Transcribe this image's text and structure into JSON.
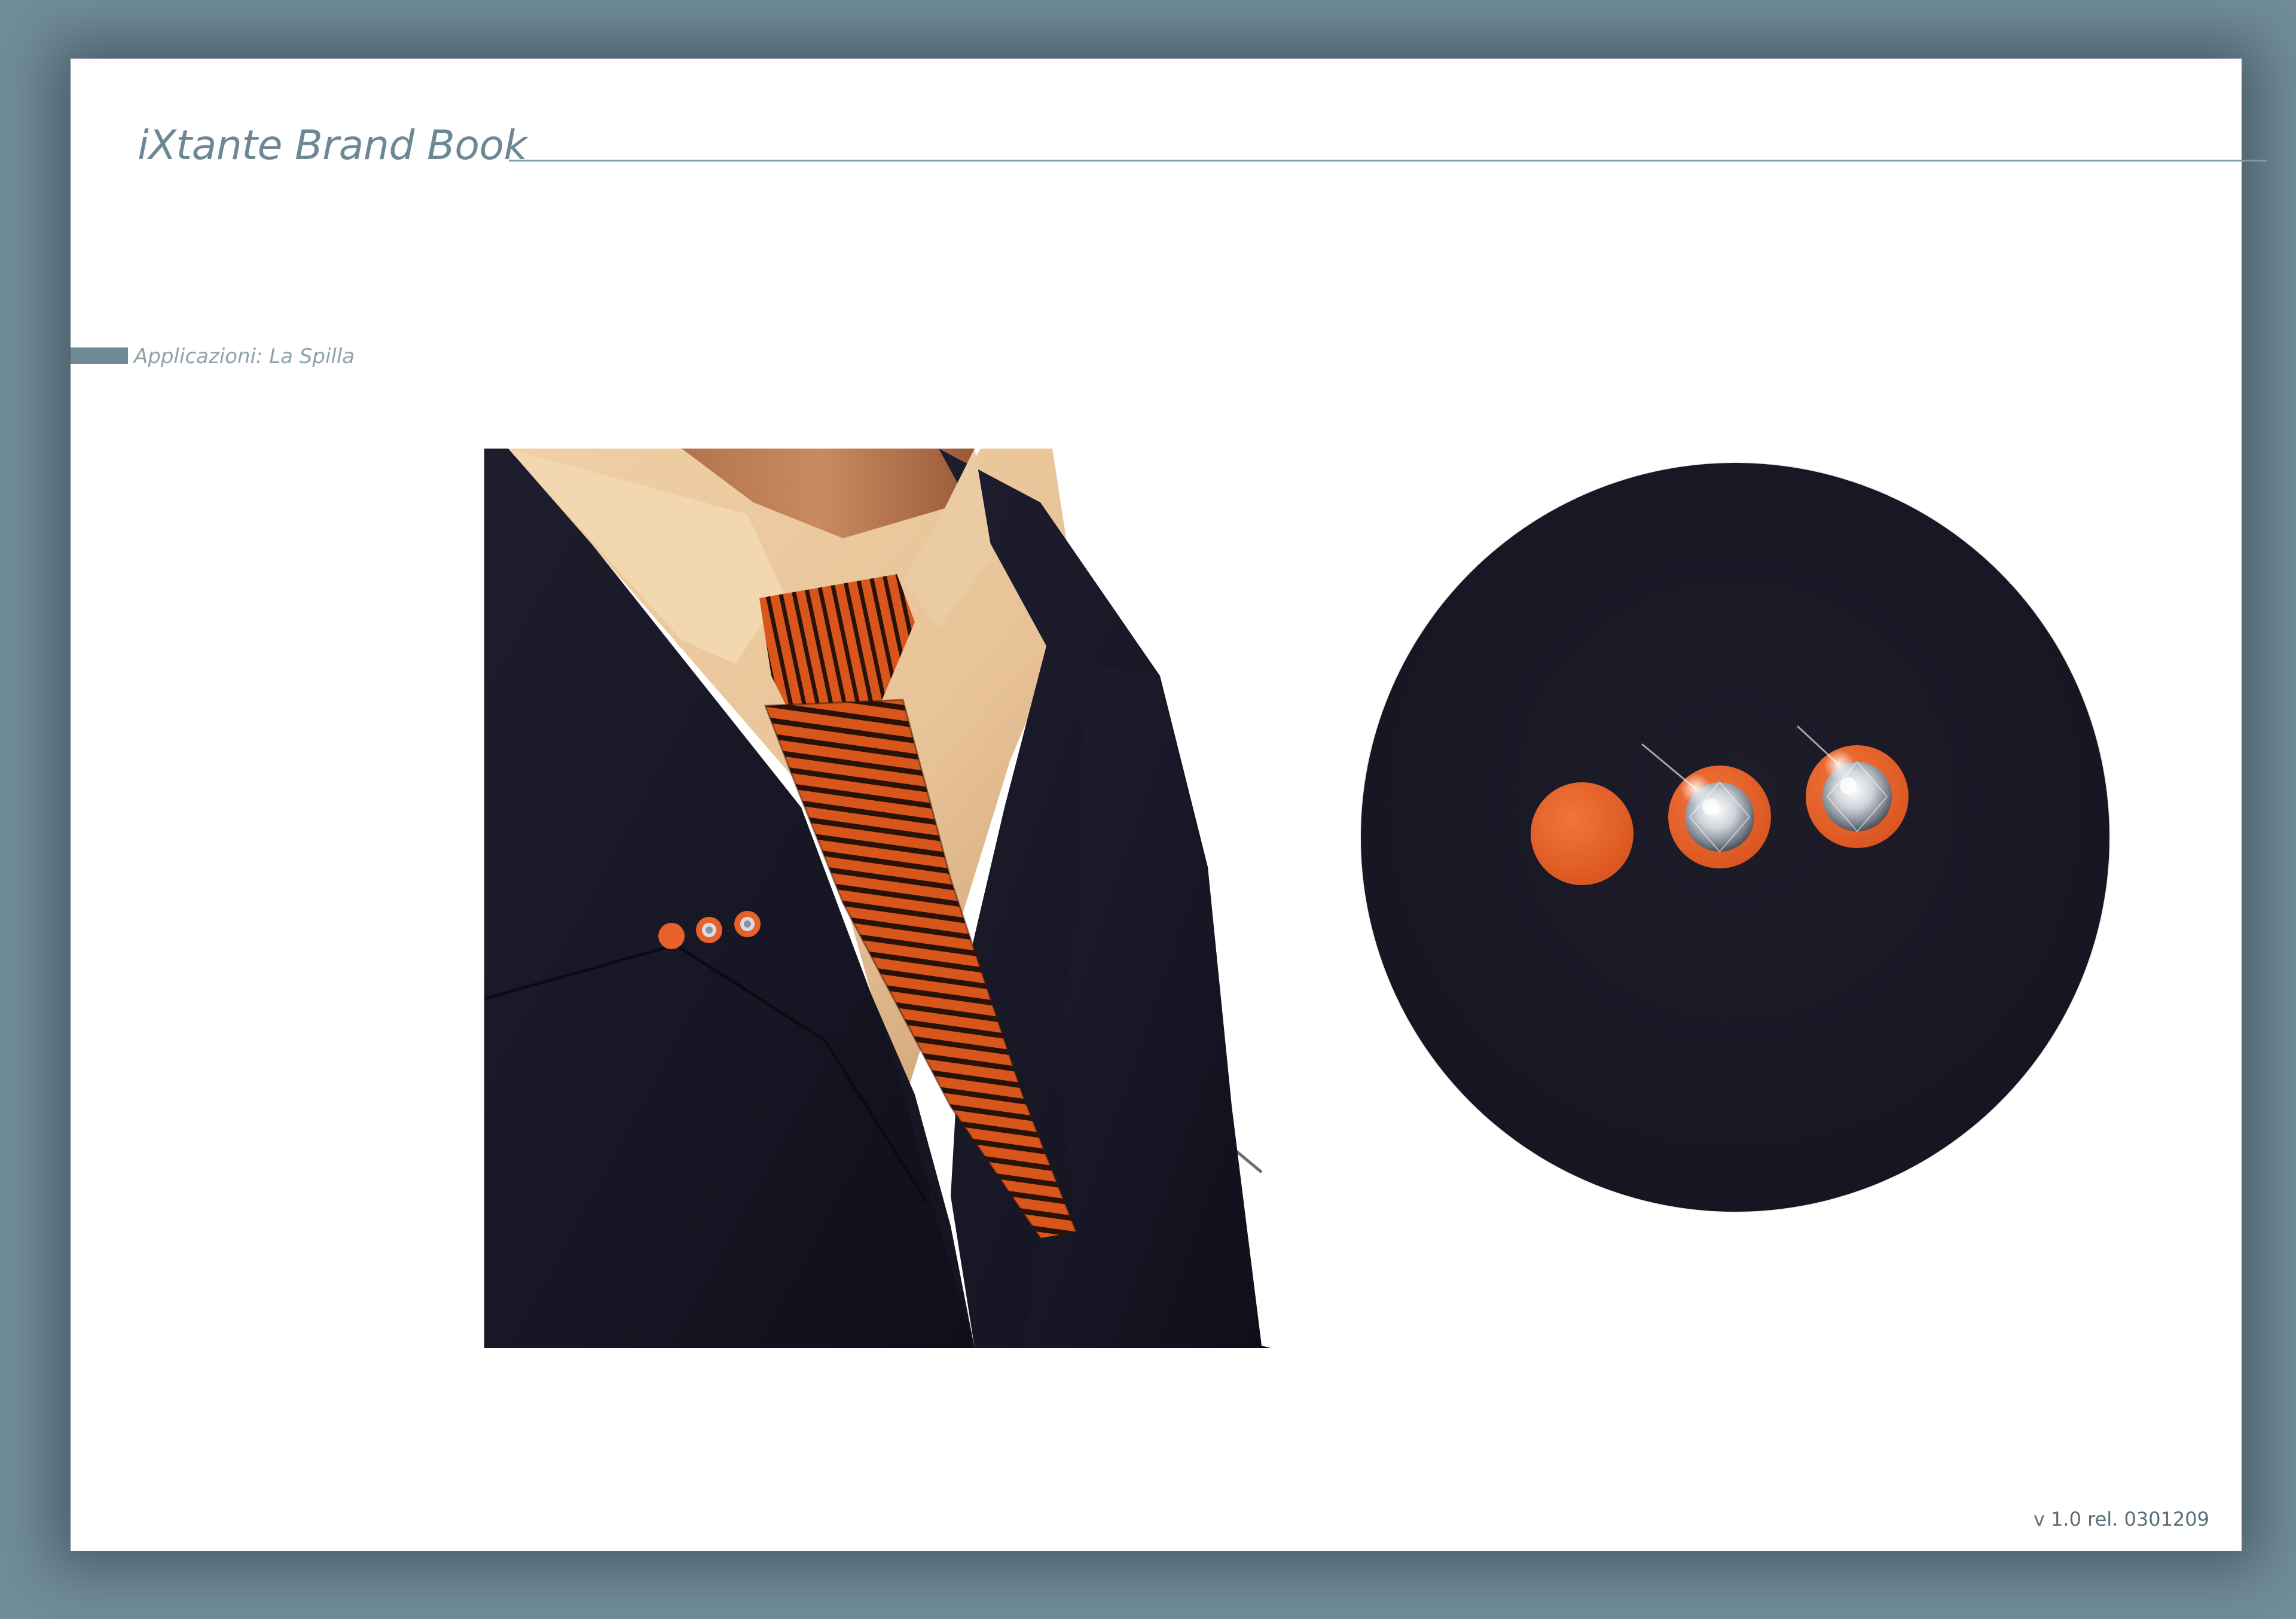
{
  "document": {
    "title": "iXtante Brand Book",
    "section": "Applicazioni: La Spilla",
    "version": "v 1.0 rel. 0301209"
  },
  "colors": {
    "background": "#718d99",
    "page": "#ffffff",
    "title_text": "#6e8795",
    "accent_orange": "#e8612a",
    "jacket_navy": "#1a1a2e"
  },
  "images": {
    "suit_photo": "suit-with-orange-striped-tie-and-pin",
    "pin_closeup": "three-orange-pins-with-crystals-closeup"
  }
}
